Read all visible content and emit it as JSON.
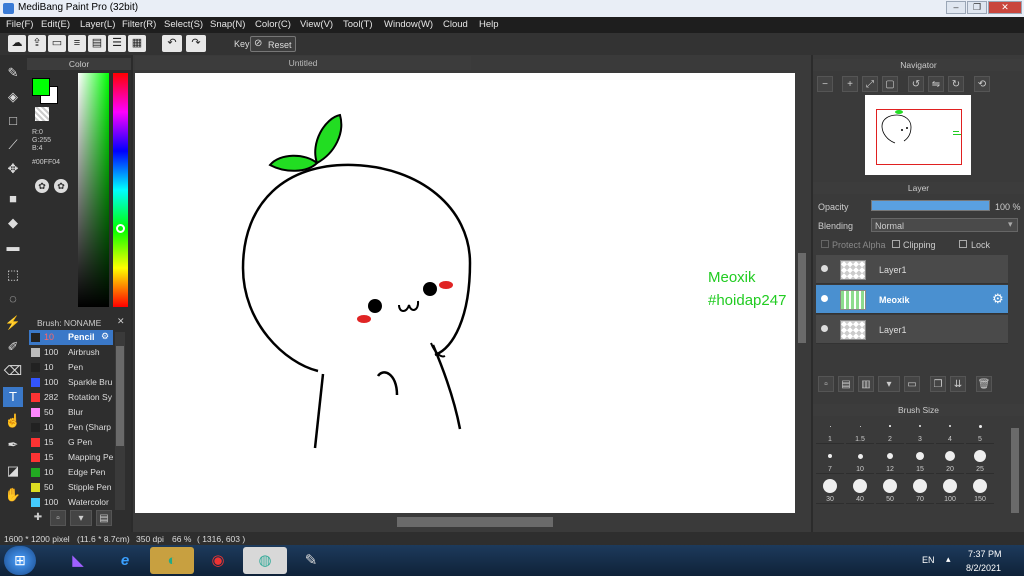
{
  "app": {
    "title": "MediBang Paint Pro (32bit)"
  },
  "window_controls": {
    "minimize": "–",
    "restore": "❐",
    "close": "✕"
  },
  "menu": [
    "File(F)",
    "Edit(E)",
    "Layer(L)",
    "Filter(R)",
    "Select(S)",
    "Snap(N)",
    "Color(C)",
    "View(V)",
    "Tool(T)",
    "Window(W)",
    "Cloud",
    "Help"
  ],
  "toolbar": {
    "key_label": "Key",
    "reset_label": "Reset"
  },
  "color_panel": {
    "title": "Color",
    "r": "R:0",
    "g": "G:255",
    "b": "B:4",
    "hex": "#00FF04",
    "fg_color": "#00ff04",
    "bg_color": "#ffffff"
  },
  "brush_panel": {
    "title": "Brush: NONAME",
    "items": [
      {
        "size": "10",
        "name": "Pencil",
        "color": "#222222"
      },
      {
        "size": "100",
        "name": "Airbrush",
        "color": "#bbbbbb"
      },
      {
        "size": "10",
        "name": "Pen",
        "color": "#222222"
      },
      {
        "size": "100",
        "name": "Sparkle Bru",
        "color": "#3355ff"
      },
      {
        "size": "282",
        "name": "Rotation Sy",
        "color": "#ff3333"
      },
      {
        "size": "50",
        "name": "Blur",
        "color": "#ff88ff"
      },
      {
        "size": "10",
        "name": "Pen (Sharp",
        "color": "#222222"
      },
      {
        "size": "15",
        "name": "G Pen",
        "color": "#ff3333"
      },
      {
        "size": "15",
        "name": "Mapping Pe",
        "color": "#ff3333"
      },
      {
        "size": "10",
        "name": "Edge Pen",
        "color": "#22aa22"
      },
      {
        "size": "50",
        "name": "Stipple Pen",
        "color": "#dddd22"
      },
      {
        "size": "100",
        "name": "Watercolor",
        "color": "#44ccff"
      }
    ]
  },
  "canvas": {
    "tab_title": "Untitled",
    "watermark_line1": "Meoxik",
    "watermark_line2": "#hoidap247"
  },
  "navigator": {
    "title": "Navigator"
  },
  "layer_panel": {
    "title": "Layer",
    "opacity_label": "Opacity",
    "opacity_value": "100 %",
    "opacity": 1.0,
    "blending_label": "Blending",
    "blending_value": "Normal",
    "protect_alpha": "Protect Alpha",
    "clipping": "Clipping",
    "lock": "Lock",
    "layers": [
      {
        "name": "Layer1",
        "selected": false
      },
      {
        "name": "Meoxik",
        "selected": true
      },
      {
        "name": "Layer1",
        "selected": false
      }
    ]
  },
  "brush_size_panel": {
    "title": "Brush Size",
    "sizes": [
      "1",
      "1.5",
      "2",
      "3",
      "4",
      "5",
      "7",
      "10",
      "12",
      "15",
      "20",
      "25",
      "30",
      "40",
      "50",
      "70",
      "100",
      "150"
    ]
  },
  "status": {
    "dimensions": "1600 * 1200 pixel",
    "physical": "(11.6 * 8.7cm)",
    "dpi": "350 dpi",
    "zoom": "66 %",
    "coords": "( 1316, 603 )"
  },
  "taskbar": {
    "lang": "EN",
    "time": "7:37 PM",
    "date": "8/2/2021"
  }
}
